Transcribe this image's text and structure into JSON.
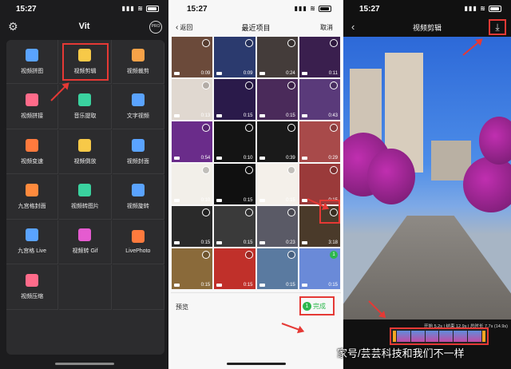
{
  "screen1": {
    "time": "15:27",
    "title": "Vit",
    "pro_label": "PRO",
    "tiles": [
      {
        "label": "视频拼图",
        "color": "#5aa3ff",
        "icon": "collage-icon"
      },
      {
        "label": "视频剪辑",
        "color": "#f7c948",
        "icon": "scissors-icon",
        "highlight": true
      },
      {
        "label": "视频裁剪",
        "color": "#f7a248",
        "icon": "crop-icon"
      },
      {
        "label": "视频拼接",
        "color": "#ff6b8a",
        "icon": "join-icon"
      },
      {
        "label": "音乐提取",
        "color": "#3ad29f",
        "icon": "music-icon"
      },
      {
        "label": "文字视频",
        "color": "#5aa3ff",
        "icon": "text-icon"
      },
      {
        "label": "视频变速",
        "color": "#ff7a3d",
        "icon": "speed-icon"
      },
      {
        "label": "视频倒放",
        "color": "#f7c948",
        "icon": "reverse-icon"
      },
      {
        "label": "视频封面",
        "color": "#5aa3ff",
        "icon": "cover-icon"
      },
      {
        "label": "九宫格封面",
        "color": "#ff8a3d",
        "icon": "grid-icon"
      },
      {
        "label": "视频转图片",
        "color": "#3ad29f",
        "icon": "image-icon"
      },
      {
        "label": "视频旋转",
        "color": "#5aa3ff",
        "icon": "rotate-icon"
      },
      {
        "label": "九宫格 Live",
        "color": "#5aa3ff",
        "icon": "live-grid-icon"
      },
      {
        "label": "视频转 Gif",
        "color": "#e55bd0",
        "icon": "gif-icon"
      },
      {
        "label": "LivePhoto",
        "color": "#ff7a3d",
        "icon": "livephoto-icon"
      },
      {
        "label": "视频压缩",
        "color": "#ff6b8a",
        "icon": "compress-icon"
      },
      {
        "label": "",
        "color": "",
        "icon": ""
      },
      {
        "label": "",
        "color": "",
        "icon": ""
      }
    ]
  },
  "screen2": {
    "time": "15:27",
    "back_label": "返回",
    "title": "最近项目",
    "cancel_label": "取消",
    "photos": [
      {
        "duration": "0:09",
        "color": "#6b4a3a"
      },
      {
        "duration": "0:09",
        "color": "#2b3a6e"
      },
      {
        "duration": "0:24",
        "color": "#443c3a"
      },
      {
        "duration": "0:11",
        "color": "#3a1f4e"
      },
      {
        "duration": "0:13",
        "color": "#e0d8d0"
      },
      {
        "duration": "0:15",
        "color": "#2a1a4a"
      },
      {
        "duration": "0:15",
        "color": "#4a2a5a"
      },
      {
        "duration": "0:43",
        "color": "#5a3a7a"
      },
      {
        "duration": "0:54",
        "color": "#6a2c8a"
      },
      {
        "duration": "0:10",
        "color": "#141414"
      },
      {
        "duration": "0:39",
        "color": "#1a1a1a"
      },
      {
        "duration": "0:29",
        "color": "#a84a4a"
      },
      {
        "duration": "0:10",
        "color": "#f2efe9"
      },
      {
        "duration": "0:15",
        "color": "#101010"
      },
      {
        "duration": "0:15",
        "color": "#f4f0ea"
      },
      {
        "duration": "0:15",
        "color": "#9a3a3a"
      },
      {
        "duration": "0:15",
        "color": "#2a2a2a"
      },
      {
        "duration": "0:15",
        "color": "#3a3a3a"
      },
      {
        "duration": "0:23",
        "color": "#5a5a66"
      },
      {
        "duration": "3:18",
        "color": "#4a3a2a"
      },
      {
        "duration": "0:15",
        "color": "#8a6a3a"
      },
      {
        "duration": "0:15",
        "color": "#c0302a"
      },
      {
        "duration": "0:15",
        "color": "#5a7aa0"
      },
      {
        "duration": "0:15",
        "color": "#6a8ad8",
        "selected": true,
        "sel_num": "1"
      },
      {
        "duration": "0:32",
        "color": "#5a4a3a"
      },
      {
        "duration": "0:15",
        "color": "#8a8a9a"
      },
      {
        "duration": "0:27",
        "color": "#6a6a5a"
      },
      {
        "duration": "0:15",
        "color": "#8a7a6a"
      },
      {
        "duration": "0:10",
        "color": "#8a3a2a"
      },
      {
        "duration": "0:10",
        "color": "#4a6a4a"
      },
      {
        "duration": "0:48",
        "color": "#2a2a2a"
      },
      {
        "duration": "2:23",
        "color": "#8aa0c0"
      }
    ],
    "preview_label": "预览",
    "done_count": "1",
    "done_label": "完成"
  },
  "screen3": {
    "time": "15:27",
    "title": "视频剪辑",
    "timeline_info": "开始 5.2s | 结束 12.9s | 总时长 7.7s (14.9s)"
  },
  "watermark": "家号/芸芸科技和我们不一样"
}
